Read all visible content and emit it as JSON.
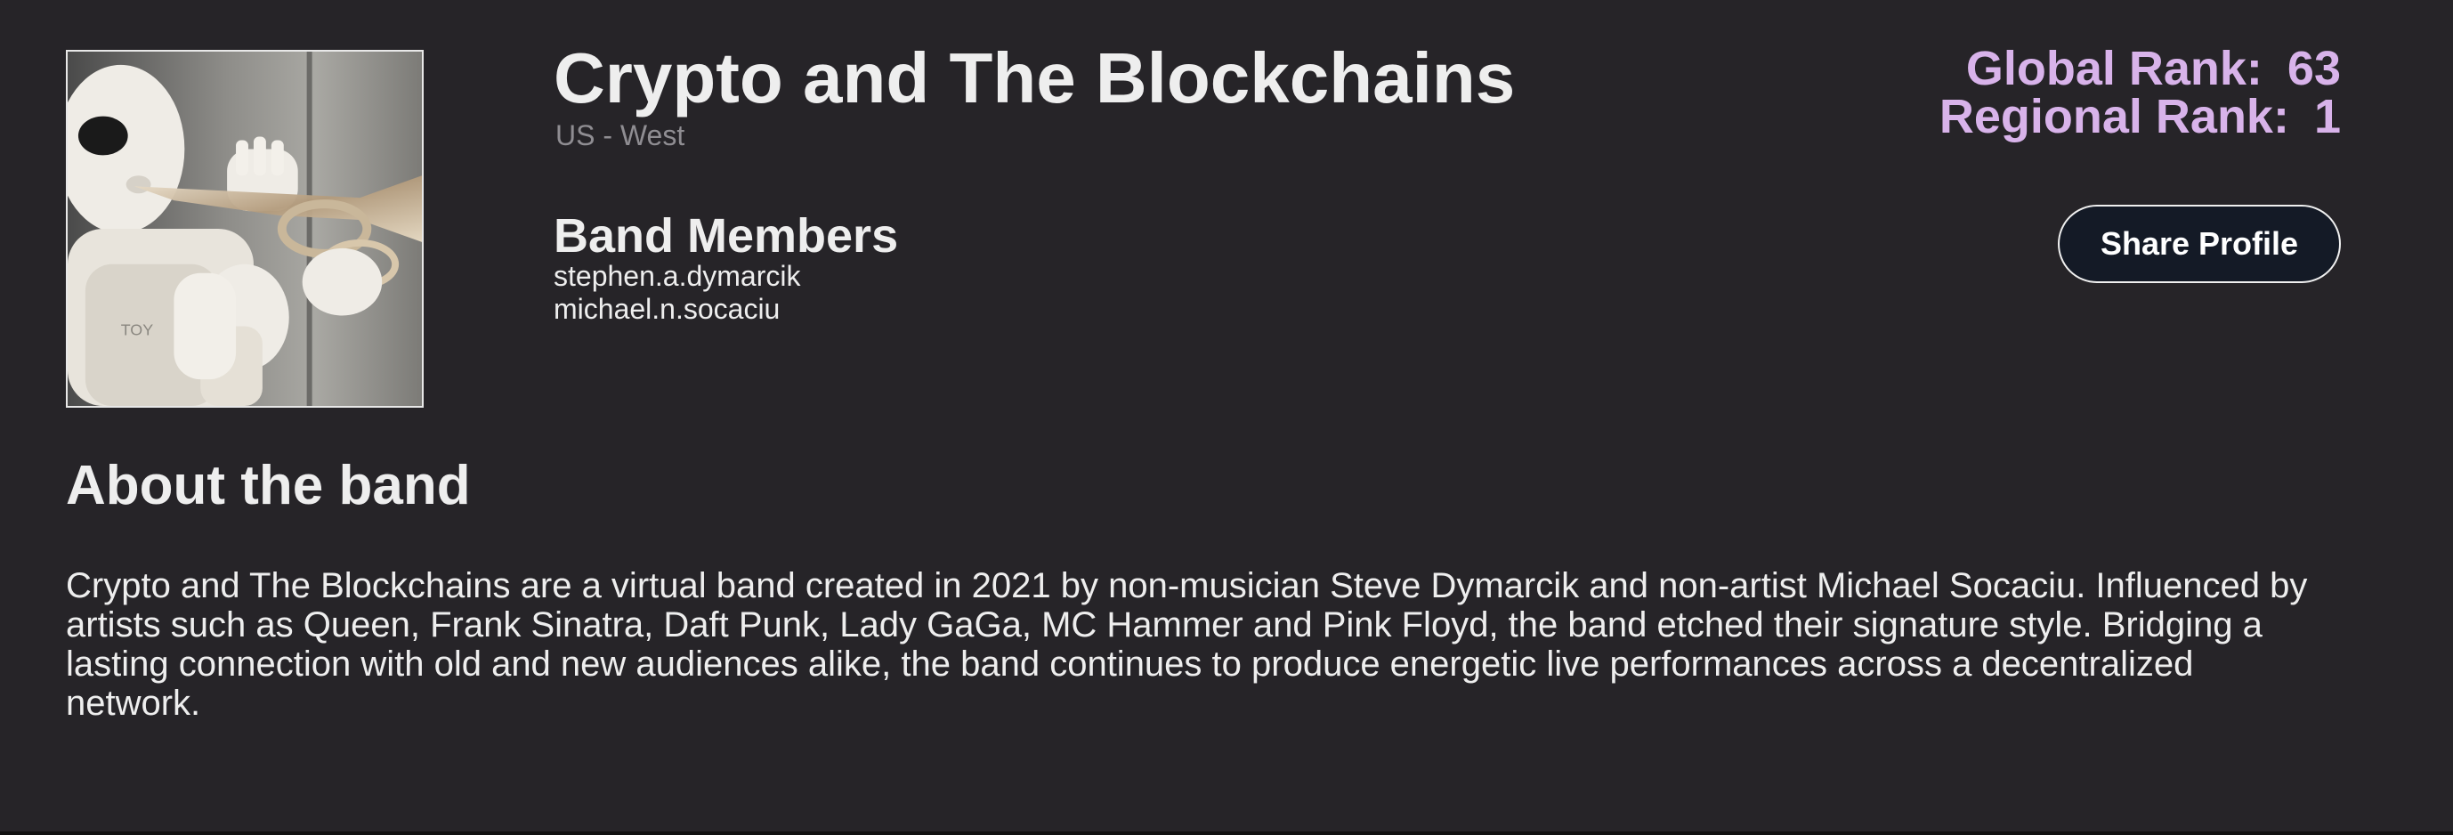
{
  "band": {
    "name": "Crypto and The Blockchains",
    "region": "US - West",
    "image_alt": "Robot playing trumpet"
  },
  "members": {
    "heading": "Band Members",
    "list": [
      "stephen.a.dymarcik",
      "michael.n.socaciu"
    ]
  },
  "ranks": {
    "global_label": "Global Rank:",
    "global_value": "63",
    "regional_label": "Regional Rank:",
    "regional_value": "1"
  },
  "actions": {
    "share_label": "Share Profile"
  },
  "about": {
    "heading": "About the band",
    "text": "Crypto and The Blockchains are a virtual band created in 2021 by non-musician Steve Dymarcik and non-artist Michael Socaciu. Influenced by artists such as Queen, Frank Sinatra, Daft Punk, Lady GaGa, MC Hammer and Pink Floyd, the band etched their signature style. Bridging a lasting connection with old and new audiences alike, the band continues to produce energetic live performances across a decentralized network."
  },
  "colors": {
    "background": "#262428",
    "rank_accent": "#d8b3ea",
    "button_bg": "#141a26"
  }
}
